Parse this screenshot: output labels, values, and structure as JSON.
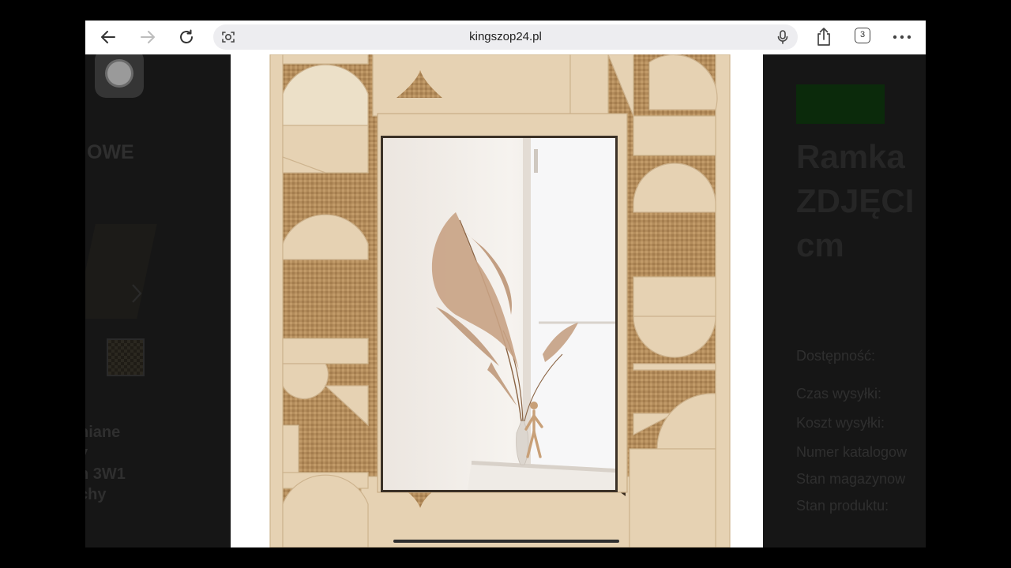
{
  "browser": {
    "url": "kingszop24.pl",
    "tab_count": "3",
    "icons": [
      "back-arrow-icon",
      "forward-arrow-icon",
      "reload-icon",
      "page-settings-icon",
      "microphone-icon",
      "share-icon",
      "tabs-icon",
      "more-icon"
    ]
  },
  "left_panel": {
    "heading_partial": "OWE",
    "product_name_lines": [
      "niane",
      "y",
      "n 3W1",
      "chy"
    ]
  },
  "right_panel": {
    "title_lines": [
      "Ramka",
      "ZDJĘCI",
      "cm"
    ],
    "details": [
      "Dostępność:",
      "Czas wysyłki:",
      "Koszt wysyłki:",
      "Numer katalogow",
      "Stan magazynow",
      "Stan produktu:"
    ],
    "badge_color": "#0b2a0b"
  },
  "colors": {
    "wood": "#e7d3b4",
    "burlap": "#b48e5e",
    "toolbar_bg": "#ffffff",
    "url_bg": "#ededf0"
  }
}
